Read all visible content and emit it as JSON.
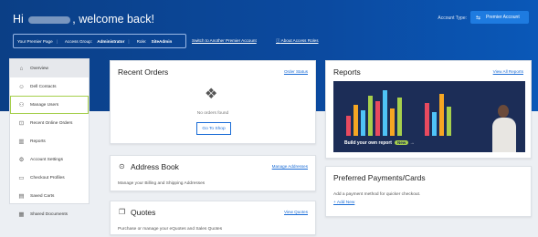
{
  "header": {
    "welcome_prefix": "Hi",
    "welcome_suffix": ", welcome back!",
    "account_type_label": "Account Type:",
    "account_type_value": "Premier Account"
  },
  "infobar": {
    "page": "Your Premier Page",
    "group_label": "Access Group:",
    "group_value": "Administrator",
    "role_label": "Role:",
    "role_value": "SiteAdmin",
    "switch_link": "Switch to Another Premier Account",
    "about_link": "About Access Roles"
  },
  "sidebar": {
    "items": [
      {
        "label": "Overview",
        "icon": "home-icon"
      },
      {
        "label": "Dell Contacts",
        "icon": "contacts-icon"
      },
      {
        "label": "Manage Users",
        "icon": "users-icon"
      },
      {
        "label": "Recent Online Orders",
        "icon": "orders-icon"
      },
      {
        "label": "Reports",
        "icon": "reports-icon"
      },
      {
        "label": "Account Settings",
        "icon": "settings-icon"
      },
      {
        "label": "Checkout Profiles",
        "icon": "checkout-icon"
      },
      {
        "label": "Saved Carts",
        "icon": "cart-icon"
      },
      {
        "label": "Shared Documents",
        "icon": "documents-icon"
      }
    ]
  },
  "orders": {
    "title": "Recent Orders",
    "link": "Order Status",
    "empty_text": "No orders found",
    "button": "Go To Shop"
  },
  "address": {
    "title": "Address Book",
    "link": "Manage Addresses",
    "description": "Manage your Billing and Shipping Addresses"
  },
  "quotes": {
    "title": "Quotes",
    "link": "View Quotes",
    "description": "Purchase or manage your eQuotes and Sales Quotes"
  },
  "reports": {
    "title": "Reports",
    "link": "View All Reports",
    "caption": "Build your own report",
    "badge": "New"
  },
  "payments": {
    "title": "Preferred Payments/Cards",
    "description": "Add a payment method for quicker checkout.",
    "add_link": "+ Add New"
  },
  "colors": {
    "banner": "#0b4aa0",
    "accent": "#1a6cd6",
    "highlight": "#a6cf4c"
  }
}
